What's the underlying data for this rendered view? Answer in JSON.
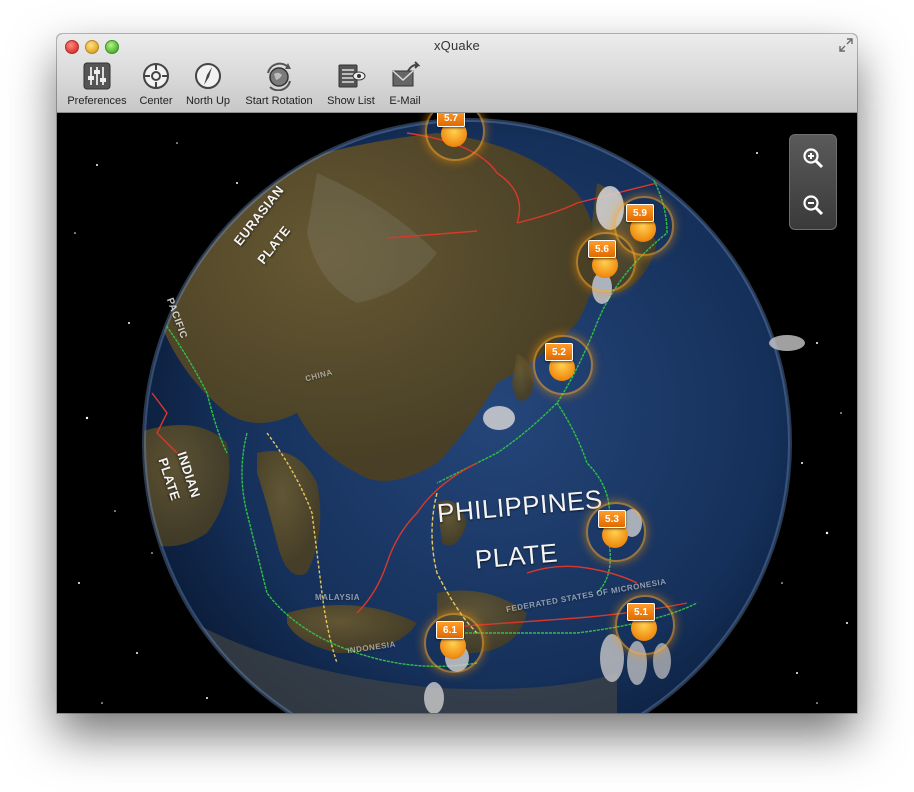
{
  "window": {
    "title": "xQuake"
  },
  "toolbar": {
    "items": [
      {
        "label": "Preferences",
        "icon": "sliders-icon"
      },
      {
        "label": "Center",
        "icon": "crosshair-icon"
      },
      {
        "label": "North Up",
        "icon": "compass-icon"
      },
      {
        "label": "Start Rotation",
        "icon": "rotate-globe-icon"
      },
      {
        "label": "Show List",
        "icon": "list-eye-icon"
      },
      {
        "label": "E-Mail",
        "icon": "envelope-icon"
      }
    ]
  },
  "map": {
    "plates": {
      "eurasian": "EURASIAN\nPLATE",
      "indian": "INDIAN\nPLATE",
      "philippines_line1": "PHILIPPINES",
      "philippines_line2": "PLATE",
      "pacific_partial": "PACIFIC"
    },
    "regions": {
      "china": "CHINA",
      "indonesia": "INDONESIA",
      "malaysia": "MALAYSIA",
      "micronesia": "FEDERATED STATES OF MICRONESIA"
    },
    "quakes": [
      {
        "magnitude": "5.7"
      },
      {
        "magnitude": "5.9"
      },
      {
        "magnitude": "5.6"
      },
      {
        "magnitude": "5.2"
      },
      {
        "magnitude": "5.3"
      },
      {
        "magnitude": "6.1"
      },
      {
        "magnitude": "5.1"
      }
    ]
  },
  "colors": {
    "quake_marker": "#f08a10",
    "boundary_convergent": "#d8382a",
    "boundary_transform": "#2fbf4a",
    "boundary_divergent": "#e8c85a",
    "ocean": "#1a3560"
  }
}
